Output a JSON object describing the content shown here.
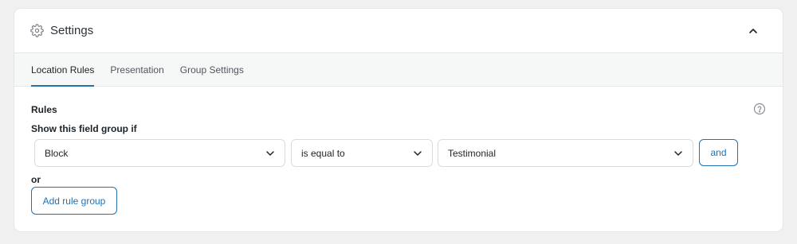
{
  "panel": {
    "title": "Settings",
    "header_icon": "gear-icon",
    "collapse_icon": "chevron-up-icon"
  },
  "tabs": [
    {
      "label": "Location Rules",
      "active": true
    },
    {
      "label": "Presentation",
      "active": false
    },
    {
      "label": "Group Settings",
      "active": false
    }
  ],
  "rules": {
    "heading": "Rules",
    "help_icon": "help-circle-icon",
    "show_label": "Show this field group if",
    "rule": {
      "param": "Block",
      "operator": "is equal to",
      "value": "Testimonial",
      "and_label": "and"
    },
    "or_label": "or",
    "add_group_label": "Add rule group"
  },
  "colors": {
    "accent": "#2271b1",
    "background": "#f0f0f1",
    "tabs_bg": "#f6f7f7"
  }
}
